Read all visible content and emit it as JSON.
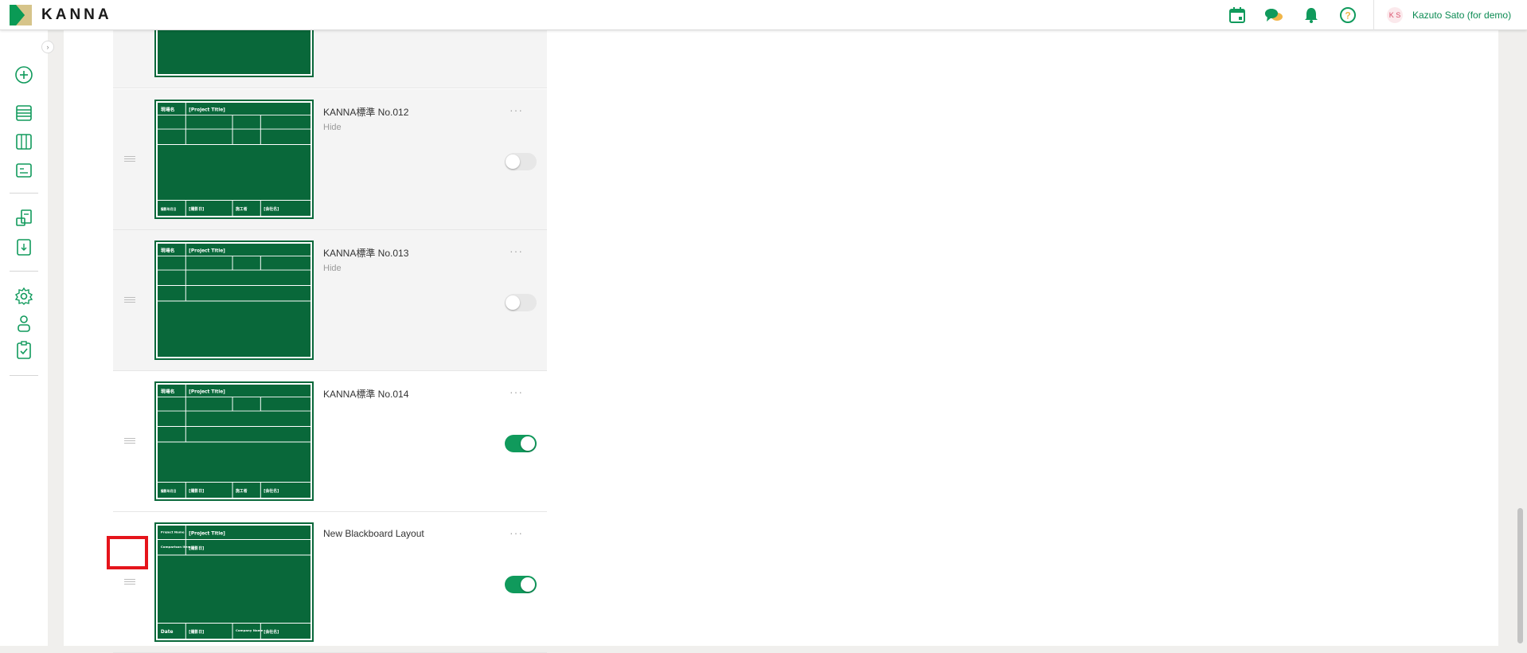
{
  "header": {
    "logo_text": "KANNA",
    "icons": [
      "calendar-icon",
      "chat-icon",
      "bell-icon",
      "help-icon"
    ],
    "user": {
      "initials": "K S",
      "name": "Kazuto Sato (for demo)"
    }
  },
  "sidebar": {
    "items": [
      "add-icon",
      "list-icon",
      "board-icon",
      "blackboard-icon",
      "report-icon",
      "download-icon",
      "settings-icon",
      "user-icon",
      "clipboard-check-icon"
    ]
  },
  "board_labels": {
    "site_name": "現場名",
    "project_title": "[Project Title]",
    "date_label": "撮影年月日",
    "date_value": "[撮影日]",
    "contractor_label": "施工者",
    "company_value": "[会社名]",
    "project_name_en": "Project Name",
    "comparison_en": "Comparison Item",
    "date_en": "Date",
    "company_name_en": "Company Name"
  },
  "rows": [
    {
      "title": "KANNA標準 No.012",
      "status": "Hide",
      "enabled": false
    },
    {
      "title": "KANNA標準 No.013",
      "status": "Hide",
      "enabled": false
    },
    {
      "title": "KANNA標準 No.014",
      "status": "",
      "enabled": true
    },
    {
      "title": "New Blackboard Layout",
      "status": "",
      "enabled": true
    }
  ],
  "more_label": "···",
  "colors": {
    "brand": "#109a5c",
    "board": "#09683a",
    "highlight": "#e5141b"
  }
}
